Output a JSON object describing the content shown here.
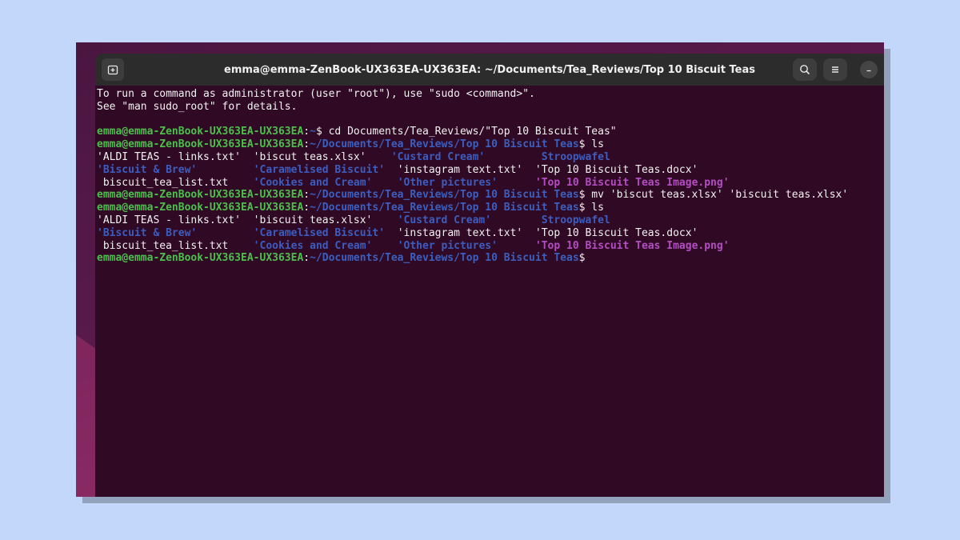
{
  "window": {
    "title": "emma@emma-ZenBook-UX363EA-UX363EA: ~/Documents/Tea_Reviews/Top 10 Biscuit Teas"
  },
  "icons": {
    "new_tab": "new-tab-icon",
    "search": "search-icon",
    "menu": "hamburger-menu-icon",
    "minimize": "minimize-icon"
  },
  "colors": {
    "terminal_bg": "#300a24",
    "user": "#4cbf4c",
    "path": "#3b5fbf",
    "directory": "#3c5dbf",
    "image_file": "#b44cc4"
  },
  "terminal": {
    "lines": [
      [
        {
          "t": "To run a command as administrator (user \"root\"), use \"sudo <command>\".",
          "c": "plain"
        }
      ],
      [
        {
          "t": "See \"man sudo_root\" for details.",
          "c": "plain"
        }
      ],
      [],
      [
        {
          "t": "emma@emma-ZenBook-UX363EA-UX363EA",
          "c": "user"
        },
        {
          "t": ":",
          "c": "plain"
        },
        {
          "t": "~",
          "c": "path"
        },
        {
          "t": "$ cd Documents/Tea_Reviews/\"Top 10 Biscuit Teas\"",
          "c": "plain"
        }
      ],
      [
        {
          "t": "emma@emma-ZenBook-UX363EA-UX363EA",
          "c": "user"
        },
        {
          "t": ":",
          "c": "plain"
        },
        {
          "t": "~/Documents/Tea_Reviews/Top 10 Biscuit Teas",
          "c": "path"
        },
        {
          "t": "$ ls",
          "c": "plain"
        }
      ],
      [
        {
          "t": "'ALDI TEAS - links.txt'  'biscut teas.xlsx'    ",
          "c": "plain"
        },
        {
          "t": "'Custard Cream'",
          "c": "dir"
        },
        {
          "t": "         ",
          "c": "plain"
        },
        {
          "t": "Stroopwafel",
          "c": "dir"
        }
      ],
      [
        {
          "t": "'Biscuit & Brew'",
          "c": "dir"
        },
        {
          "t": "         ",
          "c": "plain"
        },
        {
          "t": "'Caramelised Biscuit'",
          "c": "dir"
        },
        {
          "t": "  'instagram text.txt'  'Top 10 Biscuit Teas.docx'",
          "c": "plain"
        }
      ],
      [
        {
          "t": " biscuit_tea_list.txt    ",
          "c": "plain"
        },
        {
          "t": "'Cookies and Cream'",
          "c": "dir"
        },
        {
          "t": "    ",
          "c": "plain"
        },
        {
          "t": "'Other pictures'",
          "c": "dir"
        },
        {
          "t": "      ",
          "c": "plain"
        },
        {
          "t": "'Top 10 Biscuit Teas Image.png'",
          "c": "img"
        }
      ],
      [
        {
          "t": "emma@emma-ZenBook-UX363EA-UX363EA",
          "c": "user"
        },
        {
          "t": ":",
          "c": "plain"
        },
        {
          "t": "~/Documents/Tea_Reviews/Top 10 Biscuit Teas",
          "c": "path"
        },
        {
          "t": "$ mv 'biscut teas.xlsx' 'biscuit teas.xlsx'",
          "c": "plain"
        }
      ],
      [
        {
          "t": "emma@emma-ZenBook-UX363EA-UX363EA",
          "c": "user"
        },
        {
          "t": ":",
          "c": "plain"
        },
        {
          "t": "~/Documents/Tea_Reviews/Top 10 Biscuit Teas",
          "c": "path"
        },
        {
          "t": "$ ls",
          "c": "plain"
        }
      ],
      [
        {
          "t": "'ALDI TEAS - links.txt'  'biscuit teas.xlsx'    ",
          "c": "plain"
        },
        {
          "t": "'Custard Cream'",
          "c": "dir"
        },
        {
          "t": "        ",
          "c": "plain"
        },
        {
          "t": "Stroopwafel",
          "c": "dir"
        }
      ],
      [
        {
          "t": "'Biscuit & Brew'",
          "c": "dir"
        },
        {
          "t": "         ",
          "c": "plain"
        },
        {
          "t": "'Caramelised Biscuit'",
          "c": "dir"
        },
        {
          "t": "  'instagram text.txt'  'Top 10 Biscuit Teas.docx'",
          "c": "plain"
        }
      ],
      [
        {
          "t": " biscuit_tea_list.txt    ",
          "c": "plain"
        },
        {
          "t": "'Cookies and Cream'",
          "c": "dir"
        },
        {
          "t": "    ",
          "c": "plain"
        },
        {
          "t": "'Other pictures'",
          "c": "dir"
        },
        {
          "t": "      ",
          "c": "plain"
        },
        {
          "t": "'Top 10 Biscuit Teas Image.png'",
          "c": "img"
        }
      ],
      [
        {
          "t": "emma@emma-ZenBook-UX363EA-UX363EA",
          "c": "user"
        },
        {
          "t": ":",
          "c": "plain"
        },
        {
          "t": "~/Documents/Tea_Reviews/Top 10 Biscuit Teas",
          "c": "path"
        },
        {
          "t": "$",
          "c": "plain"
        }
      ]
    ]
  }
}
